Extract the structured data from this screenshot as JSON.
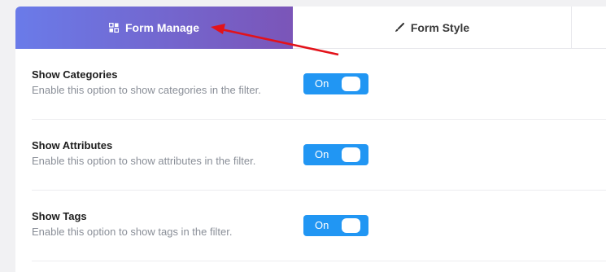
{
  "tabs": [
    {
      "label": "Form Manage",
      "icon": "grid-icon",
      "active": true
    },
    {
      "label": "Form Style",
      "icon": "brush-icon",
      "active": false
    }
  ],
  "settings": [
    {
      "title": "Show Categories",
      "description": "Enable this option to show categories in the filter.",
      "toggle": "On"
    },
    {
      "title": "Show Attributes",
      "description": "Enable this option to show attributes in the filter.",
      "toggle": "On"
    },
    {
      "title": "Show Tags",
      "description": "Enable this option to show tags in the filter.",
      "toggle": "On"
    }
  ],
  "colors": {
    "tab_gradient_start": "#6a7be9",
    "tab_gradient_end": "#7b55b8",
    "toggle_on": "#2196f3",
    "annotation_arrow": "#e3121a"
  }
}
